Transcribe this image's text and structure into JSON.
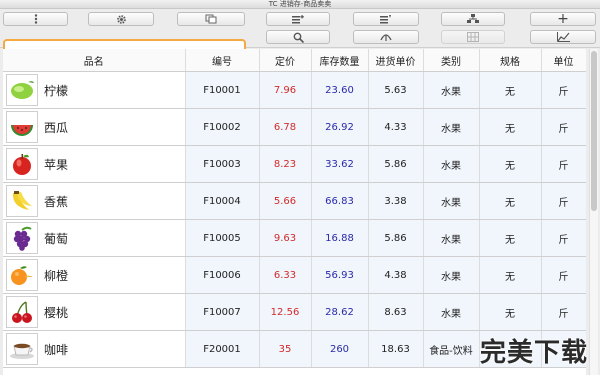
{
  "window": {
    "title": "TC 进销存-商品卖卖"
  },
  "search": {
    "value": "",
    "placeholder": ""
  },
  "table": {
    "headers": [
      "品名",
      "编号",
      "定价",
      "库存数量",
      "进货单价",
      "类别",
      "规格",
      "单位"
    ],
    "rows": [
      {
        "name": "柠檬",
        "code": "F10001",
        "price": "7.96",
        "stock": "23.60",
        "cost": "5.63",
        "category": "水果",
        "spec": "无",
        "unit": "斤",
        "icon": "lemon-icon"
      },
      {
        "name": "西瓜",
        "code": "F10002",
        "price": "6.78",
        "stock": "26.92",
        "cost": "4.33",
        "category": "水果",
        "spec": "无",
        "unit": "斤",
        "icon": "watermelon-icon"
      },
      {
        "name": "苹果",
        "code": "F10003",
        "price": "8.23",
        "stock": "33.62",
        "cost": "5.86",
        "category": "水果",
        "spec": "无",
        "unit": "斤",
        "icon": "apple-icon"
      },
      {
        "name": "香蕉",
        "code": "F10004",
        "price": "5.66",
        "stock": "66.83",
        "cost": "3.38",
        "category": "水果",
        "spec": "无",
        "unit": "斤",
        "icon": "banana-icon"
      },
      {
        "name": "葡萄",
        "code": "F10005",
        "price": "9.63",
        "stock": "16.88",
        "cost": "5.86",
        "category": "水果",
        "spec": "无",
        "unit": "斤",
        "icon": "grape-icon"
      },
      {
        "name": "柳橙",
        "code": "F10006",
        "price": "6.33",
        "stock": "56.93",
        "cost": "4.38",
        "category": "水果",
        "spec": "无",
        "unit": "斤",
        "icon": "orange-icon"
      },
      {
        "name": "樱桃",
        "code": "F10007",
        "price": "12.56",
        "stock": "28.62",
        "cost": "8.63",
        "category": "水果",
        "spec": "无",
        "unit": "斤",
        "icon": "cherry-icon"
      },
      {
        "name": "咖啡",
        "code": "F20001",
        "price": "35",
        "stock": "260",
        "cost": "18.63",
        "category": "食品-饮料",
        "spec": "",
        "unit": "",
        "icon": "coffee-icon"
      }
    ]
  },
  "watermark": {
    "text": "完美下载"
  },
  "colors": {
    "search_focus": "#f4a942",
    "price": "#d12b2b",
    "stock": "#2a2aa8",
    "cell_bg": "#f1f6fc"
  }
}
